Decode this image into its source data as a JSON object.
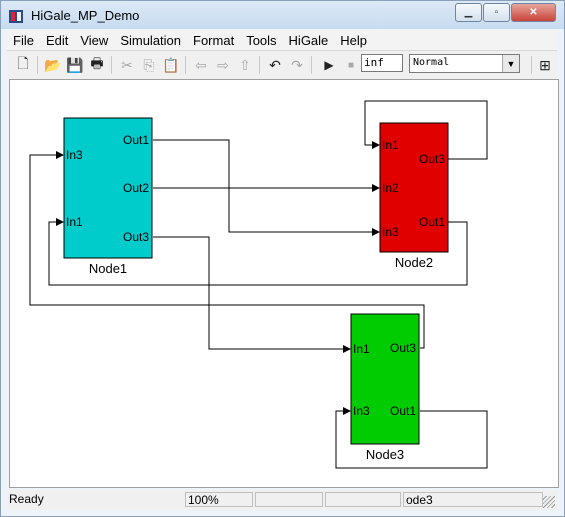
{
  "window": {
    "title": "HiGale_MP_Demo"
  },
  "menu": [
    "File",
    "Edit",
    "View",
    "Simulation",
    "Format",
    "Tools",
    "HiGale",
    "Help"
  ],
  "toolbar": {
    "stop_time": "inf",
    "mode": "Normal",
    "icons": [
      "new-icon",
      "open-icon",
      "save-icon",
      "print-icon",
      "cut-icon",
      "copy-icon",
      "paste-icon",
      "back-icon",
      "forward-icon",
      "up-icon",
      "undo-icon",
      "redo-icon",
      "run-icon",
      "stop-icon",
      "library-icon"
    ]
  },
  "diagram": {
    "blocks": [
      {
        "id": "Node1",
        "label": "Node1",
        "color": "#00cccc",
        "inputs": [
          "In3",
          "In1"
        ],
        "outputs": [
          "Out1",
          "Out2",
          "Out3"
        ]
      },
      {
        "id": "Node2",
        "label": "Node2",
        "color": "#e00000",
        "inputs": [
          "In1",
          "In2",
          "In3"
        ],
        "outputs": [
          "Out3",
          "Out1"
        ]
      },
      {
        "id": "Node3",
        "label": "Node3",
        "color": "#00cc00",
        "inputs": [
          "In1",
          "In3"
        ],
        "outputs": [
          "Out3",
          "Out1"
        ]
      }
    ],
    "connections": [
      {
        "from": "Node1.Out1",
        "to": "Node2.In3"
      },
      {
        "from": "Node1.Out2",
        "to": "Node2.In2"
      },
      {
        "from": "Node1.Out3",
        "to": "Node3.In1"
      },
      {
        "from": "Node2.Out3",
        "to": "Node2.In1"
      },
      {
        "from": "Node2.Out1",
        "to": "Node1.In1"
      },
      {
        "from": "Node3.Out3",
        "to": "Node1.In3"
      },
      {
        "from": "Node3.Out1",
        "to": "Node3.In3"
      }
    ]
  },
  "status": {
    "state": "Ready",
    "zoom": "100%",
    "extra1": "",
    "extra2": "",
    "block": "ode3"
  }
}
